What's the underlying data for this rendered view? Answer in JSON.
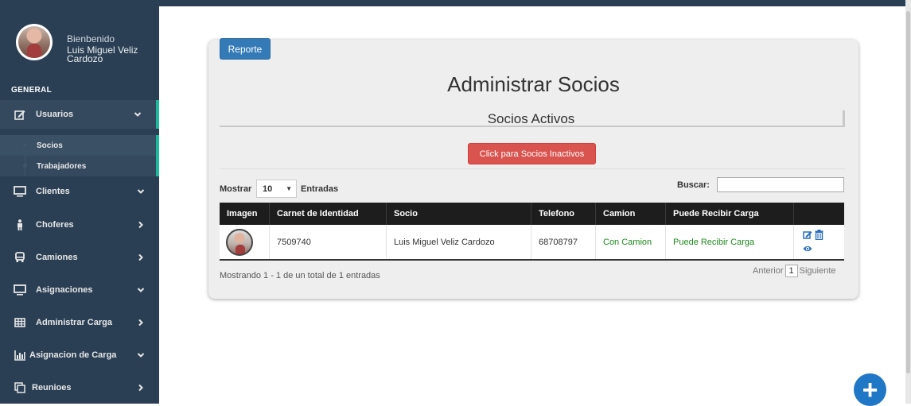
{
  "profile": {
    "welcome": "Bienbenido",
    "name": "Luis Miguel Veliz Cardozo"
  },
  "sidebar": {
    "section": "GENERAL",
    "items": [
      {
        "label": "Usuarios",
        "icon": "edit-icon",
        "chevron": "down"
      },
      {
        "label": "Clientes",
        "icon": "monitor-icon",
        "chevron": "down"
      },
      {
        "label": "Choferes",
        "icon": "person-icon",
        "chevron": "right"
      },
      {
        "label": "Camiones",
        "icon": "truck-icon",
        "chevron": "right"
      },
      {
        "label": "Asignaciones",
        "icon": "monitor-icon",
        "chevron": "down"
      },
      {
        "label": "Administrar Carga",
        "icon": "table-icon",
        "chevron": "right"
      },
      {
        "label": "Asignacion de Carga",
        "icon": "bar-chart-icon",
        "chevron": "down"
      },
      {
        "label": "Reunioes",
        "icon": "clone-icon",
        "chevron": "right"
      }
    ],
    "submenu": [
      {
        "label": "Socios"
      },
      {
        "label": "Trabajadores"
      }
    ]
  },
  "main": {
    "report_button": "Reporte",
    "title": "Administrar Socios",
    "subtitle": "Socios Activos",
    "inactive_button": "Click para Socios Inactivos",
    "show_label": "Mostrar",
    "show_value": "10",
    "entries_label": "Entradas",
    "search_label": "Buscar:",
    "search_value": ""
  },
  "table": {
    "columns": [
      "Imagen",
      "Carnet de Identidad",
      "Socio",
      "Telefono",
      "Camion",
      "Puede Recibir Carga",
      ""
    ],
    "rows": [
      {
        "carnet": "7509740",
        "socio": "Luis Miguel Veliz Cardozo",
        "telefono": "68708797",
        "camion": "Con Camion",
        "carga": "Puede Recibir Carga"
      }
    ],
    "info": "Mostrando 1 - 1 de un total de 1 entradas",
    "pager": {
      "prev": "Anterior",
      "page": "1",
      "next": "Siguiente"
    }
  },
  "colors": {
    "sidebar": "#2a3f54",
    "accent": "#1abb9c",
    "primary": "#337ab7",
    "danger": "#d9534f",
    "success_text": "#1e8a1e",
    "fab": "#1f77c5"
  },
  "fab": {
    "icon": "plus-icon",
    "symbol": "+"
  }
}
